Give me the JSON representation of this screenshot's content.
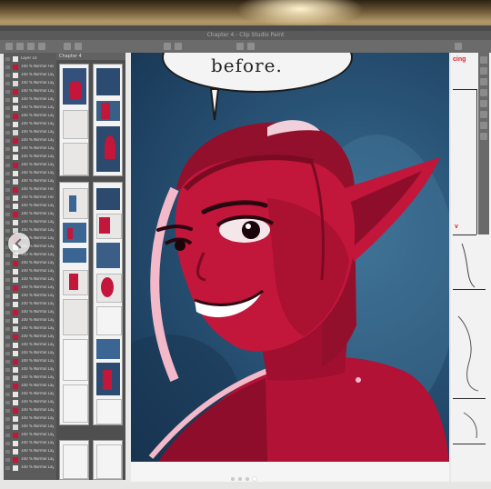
{
  "app": {
    "title_text": "Chapter 4 - Clip Studio Paint"
  },
  "pages_panel": {
    "header": "Chapter 4"
  },
  "layers": [
    {
      "label": "Layer 10"
    },
    {
      "label": "100 % Normal Folder 3"
    },
    {
      "label": "100 % Normal Layer 48"
    },
    {
      "label": "100 % Normal Layer 47"
    },
    {
      "label": "100 % Normal Layer 46"
    },
    {
      "label": "100 % Normal Layer 45"
    },
    {
      "label": "100 % Normal Layer 44"
    },
    {
      "label": "100 % Normal Layer 43"
    },
    {
      "label": "100 % Normal Layer 42"
    },
    {
      "label": "100 % Normal Layer 41"
    },
    {
      "label": "100 % Normal Layer 40"
    },
    {
      "label": "100 % Normal Layer 39"
    },
    {
      "label": "100 % Normal Layer 38"
    },
    {
      "label": "100 % Normal Layer 37"
    },
    {
      "label": "100 % Normal Layer 36"
    },
    {
      "label": "100 % Normal Layer 35"
    },
    {
      "label": "100 % Normal Folder 2"
    },
    {
      "label": "100 % Normal Folder 1"
    },
    {
      "label": "100 % Normal Layer 34"
    },
    {
      "label": "100 % Normal Layer 33"
    },
    {
      "label": "100 % Normal Layer 32"
    },
    {
      "label": "100 % Normal Layer 31"
    },
    {
      "label": "100 % Normal Layer 30"
    },
    {
      "label": "100 % Normal Layer 29"
    },
    {
      "label": "100 % Normal Layer 28"
    },
    {
      "label": "100 % Normal Layer 27"
    },
    {
      "label": "100 % Normal Layer 26"
    },
    {
      "label": "100 % Normal Layer 25"
    },
    {
      "label": "100 % Normal Layer 24"
    },
    {
      "label": "100 % Normal Layer 23"
    },
    {
      "label": "100 % Normal Layer 22"
    },
    {
      "label": "100 % Normal Layer 21"
    },
    {
      "label": "100 % Normal Layer 20"
    },
    {
      "label": "100 % Normal Layer 19"
    },
    {
      "label": "100 % Normal Layer 18"
    },
    {
      "label": "100 % Normal Layer 17"
    },
    {
      "label": "100 % Normal Layer 16"
    },
    {
      "label": "100 % Normal Layer 15"
    },
    {
      "label": "100 % Normal Layer 14"
    },
    {
      "label": "100 % Normal Layer 13"
    },
    {
      "label": "100 % Normal Layer 12"
    },
    {
      "label": "100 % Normal Layer 11"
    },
    {
      "label": "100 % Normal Layer 10"
    },
    {
      "label": "100 % Normal Layer 9"
    },
    {
      "label": "100 % Normal Layer 8"
    },
    {
      "label": "100 % Normal Layer 7"
    },
    {
      "label": "100 % Normal Layer 6"
    },
    {
      "label": "100 % Normal Layer 5"
    },
    {
      "label": "100 % Normal Layer 4"
    },
    {
      "label": "100 % Normal Layer 3"
    },
    {
      "label": "100 % Normal Layer 2"
    },
    {
      "label": "100 % Normal Layer 1"
    }
  ],
  "canvas": {
    "speech_text": "before."
  },
  "right_panel": {
    "top_text": "cing",
    "mid_text": "v"
  },
  "colors": {
    "skin": "#c2163b",
    "skin_shadow": "#8e0d2a",
    "hair": "#93102c",
    "background": "#2a5578",
    "rim_light": "#f3b9c9",
    "accent_red": "#e2202a"
  }
}
